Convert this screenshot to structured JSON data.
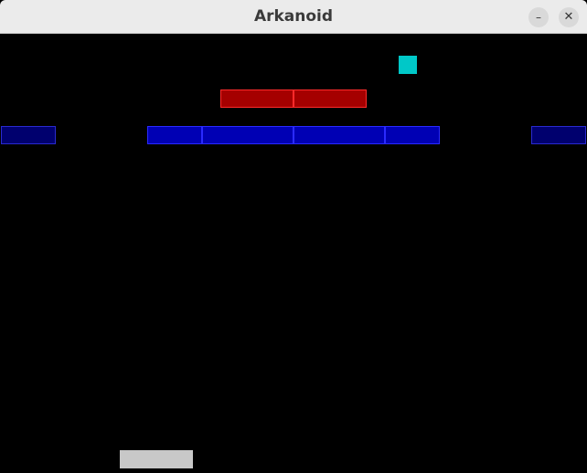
{
  "window": {
    "title": "Arkanoid",
    "minimize_glyph": "–",
    "close_glyph": "✕"
  },
  "game": {
    "colors": {
      "background": "#000000",
      "brick_blue": "#0000b4",
      "brick_blue_dim": "#00006e",
      "brick_red": "#a50000",
      "ball": "#00c8c8",
      "paddle": "#c8c8c8"
    },
    "bricks": [
      {
        "row": "red",
        "color": "red"
      },
      {
        "row": "red",
        "color": "red"
      },
      {
        "row": "blue",
        "color": "blue-dim"
      },
      {
        "row": "blue",
        "color": "blue"
      },
      {
        "row": "blue",
        "color": "blue"
      },
      {
        "row": "blue",
        "color": "blue"
      },
      {
        "row": "blue",
        "color": "blue"
      },
      {
        "row": "blue",
        "color": "blue-dim"
      }
    ]
  }
}
